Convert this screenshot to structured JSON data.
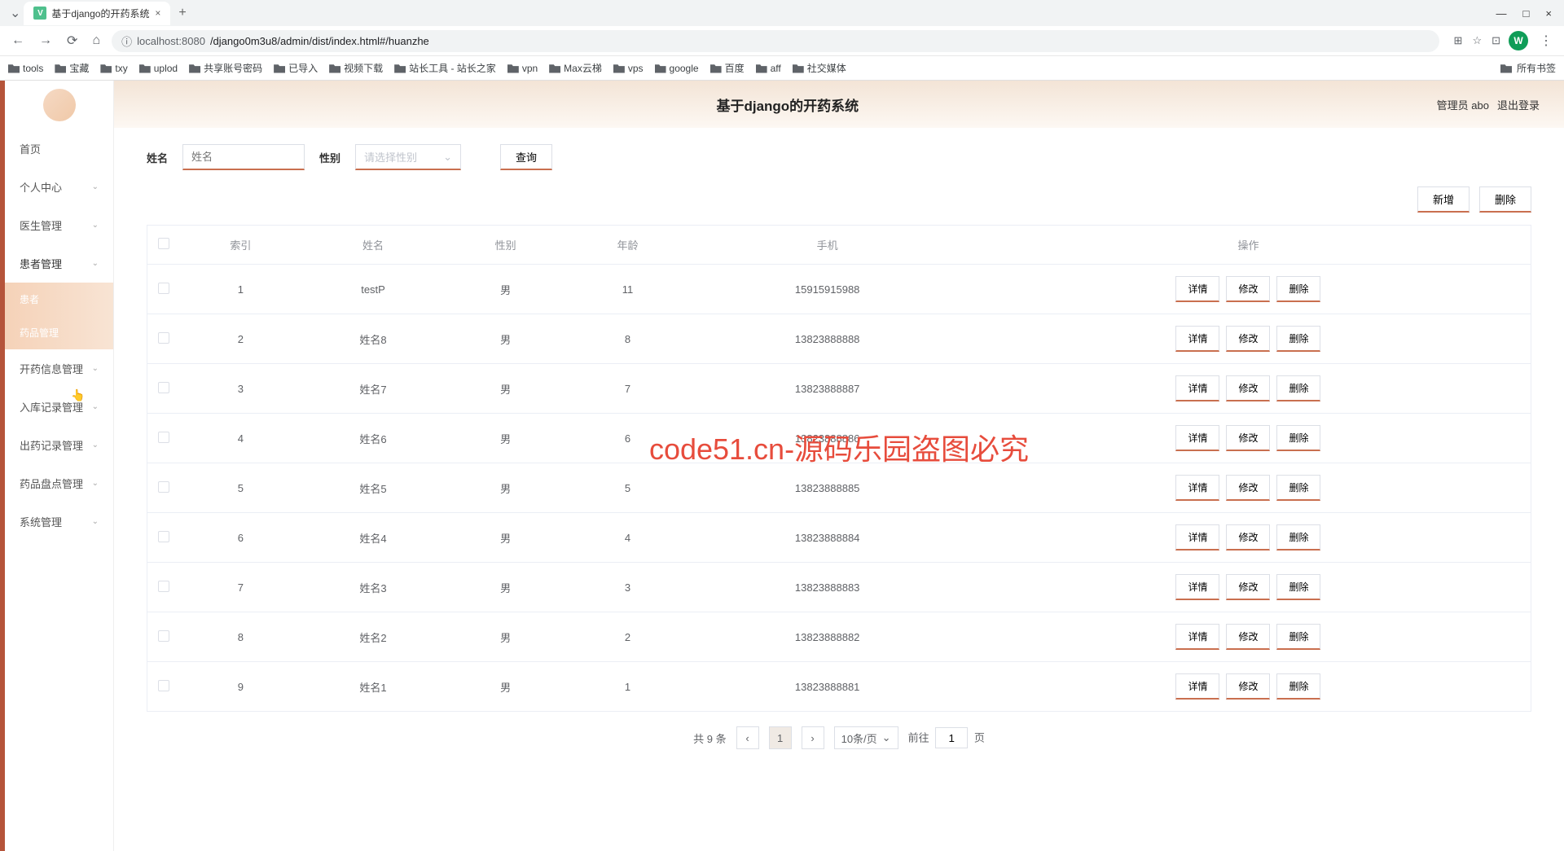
{
  "browser": {
    "tab_title": "基于django的开药系统",
    "url_host": "localhost:8080",
    "url_path": "/django0m3u8/admin/dist/index.html#/huanzhe",
    "bookmarks": [
      "tools",
      "宝藏",
      "txy",
      "uplod",
      "共享账号密码",
      "已导入",
      "视频下载",
      "站长工具 - 站长之家",
      "vpn",
      "Max云梯",
      "vps",
      "google",
      "百度",
      "aff",
      "社交媒体"
    ],
    "all_bookmarks": "所有书签"
  },
  "header": {
    "title": "基于django的开药系统",
    "user_label": "管理员 abo",
    "logout": "退出登录"
  },
  "sidebar": {
    "items": [
      "首页",
      "个人中心",
      "医生管理",
      "患者管理"
    ],
    "sub_items": [
      "患者",
      "药品管理"
    ],
    "items2": [
      "开药信息管理",
      "入库记录管理",
      "出药记录管理",
      "药品盘点管理",
      "系统管理"
    ]
  },
  "filter": {
    "name_label": "姓名",
    "name_placeholder": "姓名",
    "gender_label": "性别",
    "gender_placeholder": "请选择性别",
    "query": "查询"
  },
  "actions": {
    "add": "新增",
    "delete": "删除"
  },
  "table": {
    "headers": [
      "索引",
      "姓名",
      "性别",
      "年龄",
      "手机",
      "操作"
    ],
    "op_detail": "详情",
    "op_edit": "修改",
    "op_delete": "删除",
    "rows": [
      {
        "idx": "1",
        "name": "testP",
        "gender": "男",
        "age": "11",
        "phone": "15915915988"
      },
      {
        "idx": "2",
        "name": "姓名8",
        "gender": "男",
        "age": "8",
        "phone": "13823888888"
      },
      {
        "idx": "3",
        "name": "姓名7",
        "gender": "男",
        "age": "7",
        "phone": "13823888887"
      },
      {
        "idx": "4",
        "name": "姓名6",
        "gender": "男",
        "age": "6",
        "phone": "13823888886"
      },
      {
        "idx": "5",
        "name": "姓名5",
        "gender": "男",
        "age": "5",
        "phone": "13823888885"
      },
      {
        "idx": "6",
        "name": "姓名4",
        "gender": "男",
        "age": "4",
        "phone": "13823888884"
      },
      {
        "idx": "7",
        "name": "姓名3",
        "gender": "男",
        "age": "3",
        "phone": "13823888883"
      },
      {
        "idx": "8",
        "name": "姓名2",
        "gender": "男",
        "age": "2",
        "phone": "13823888882"
      },
      {
        "idx": "9",
        "name": "姓名1",
        "gender": "男",
        "age": "1",
        "phone": "13823888881"
      }
    ]
  },
  "pagination": {
    "total": "共 9 条",
    "current": "1",
    "page_size": "10条/页",
    "goto": "前往",
    "goto_suffix": "页",
    "goto_value": "1"
  },
  "watermark": "code51.cn-源码乐园盗图必究"
}
